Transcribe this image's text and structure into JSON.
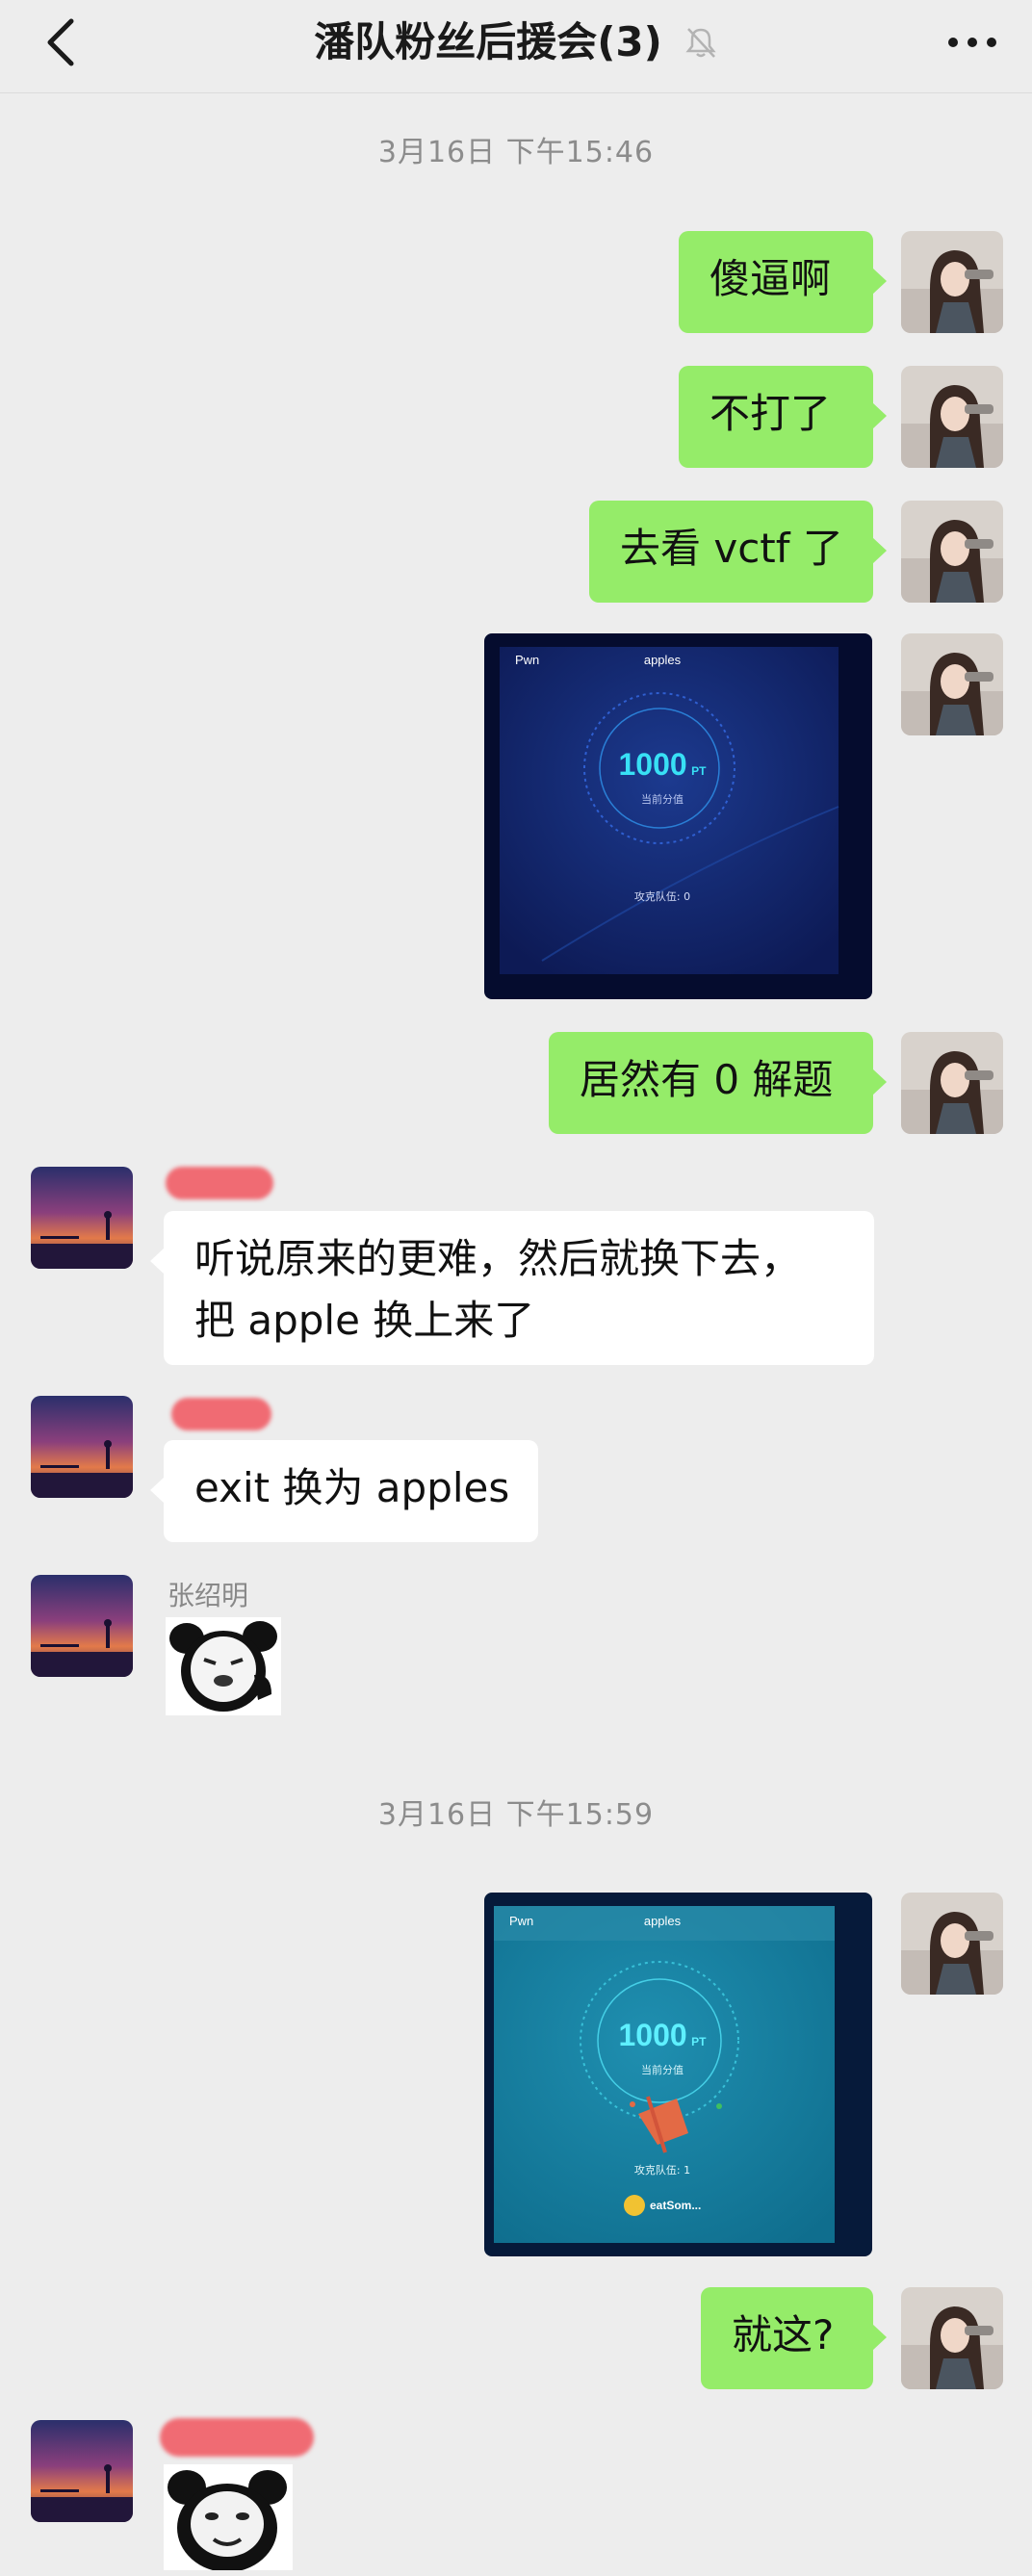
{
  "header": {
    "title": "潘队粉丝后援会(3)",
    "back_icon": "chevron-left-icon",
    "mute_icon": "bell-off-icon",
    "more_icon": "more-dots-icon"
  },
  "timestamps": [
    "3月16日 下午15:46",
    "3月16日 下午15:59"
  ],
  "messages": {
    "m1": "傻逼啊",
    "m2": "不打了",
    "m3": "去看 vctf 了",
    "m5": "居然有 0 解题",
    "m6_line1": "听说原来的更难，然后就换下去，",
    "m6_line2": "把 apple 换上来了",
    "m7": "exit 换为 apples",
    "m8_sender": "张绍明",
    "m10": "就这?"
  },
  "screenshot1": {
    "category": "Pwn",
    "challenge": "apples",
    "score": "1000",
    "unit": "PT",
    "score_label": "当前分值",
    "teams_label": "攻克队伍: 0"
  },
  "screenshot2": {
    "category": "Pwn",
    "challenge": "apples",
    "score": "1000",
    "unit": "PT",
    "score_label": "当前分值",
    "teams_label": "攻克队伍: 1",
    "solver": "eatSom..."
  },
  "colors": {
    "my_bubble": "#95ec69",
    "other_bubble": "#ffffff",
    "background": "#ededed",
    "name_redaction": "#f06b73"
  }
}
